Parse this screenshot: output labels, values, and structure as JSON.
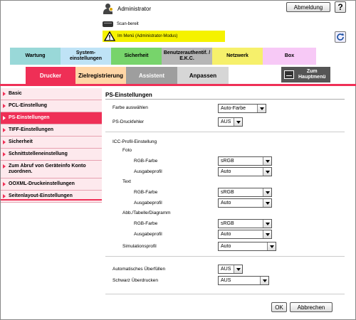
{
  "header": {
    "username": "Administrator",
    "logout_label": "Abmeldung",
    "help_label": "?",
    "status_scan": "Scan-bereit",
    "status_mode": "Im Menü (Administrator-Modus)"
  },
  "top_tabs": [
    "Wartung",
    "System-\neinstellungen",
    "Sicherheit",
    "Benutzerauthentif. /\nE.K.C.",
    "Netzwerk",
    "Box"
  ],
  "sub_tabs": [
    "Drucker",
    "Zielregistrierung",
    "Assistent",
    "Anpassen"
  ],
  "home_label": "Zum\nHauptmenü",
  "sidebar": [
    "Basic",
    "PCL-Einstellung",
    "PS-Einstellungen",
    "TIFF-Einstellungen",
    "Sicherheit",
    "Schnittstelleneinstellung",
    "Zum Abruf von Geräteinfo Konto zuordnen.",
    "OOXML-Druckeinstellungen",
    "Seitenlayout-Einstellungen"
  ],
  "main": {
    "title": "PS-Einstellungen",
    "farbe_label": "Farbe auswählen",
    "farbe_value": "Auto-Farbe",
    "druckfehler_label": "PS-Druckfehler",
    "druckfehler_value": "AUS",
    "icc_label": "ICC-Profil-Einstellung",
    "foto_label": "Foto",
    "text_label": "Text",
    "abb_label": "Abb./Tabelle/Diagramm",
    "rgb_label": "RGB-Farbe",
    "ausgabe_label": "Ausgabeprofil",
    "rgb_value": "sRGB",
    "ausgabe_value": "Auto",
    "simulation_label": "Simulationsprofil",
    "simulation_value": "Auto",
    "ueberfuellen_label": "Automatisches Überfüllen",
    "ueberfuellen_value": "AUS",
    "schwarz_label": "Schwarz Überdrucken",
    "schwarz_value": "AUS",
    "ok_label": "OK",
    "cancel_label": "Abbrechen"
  }
}
